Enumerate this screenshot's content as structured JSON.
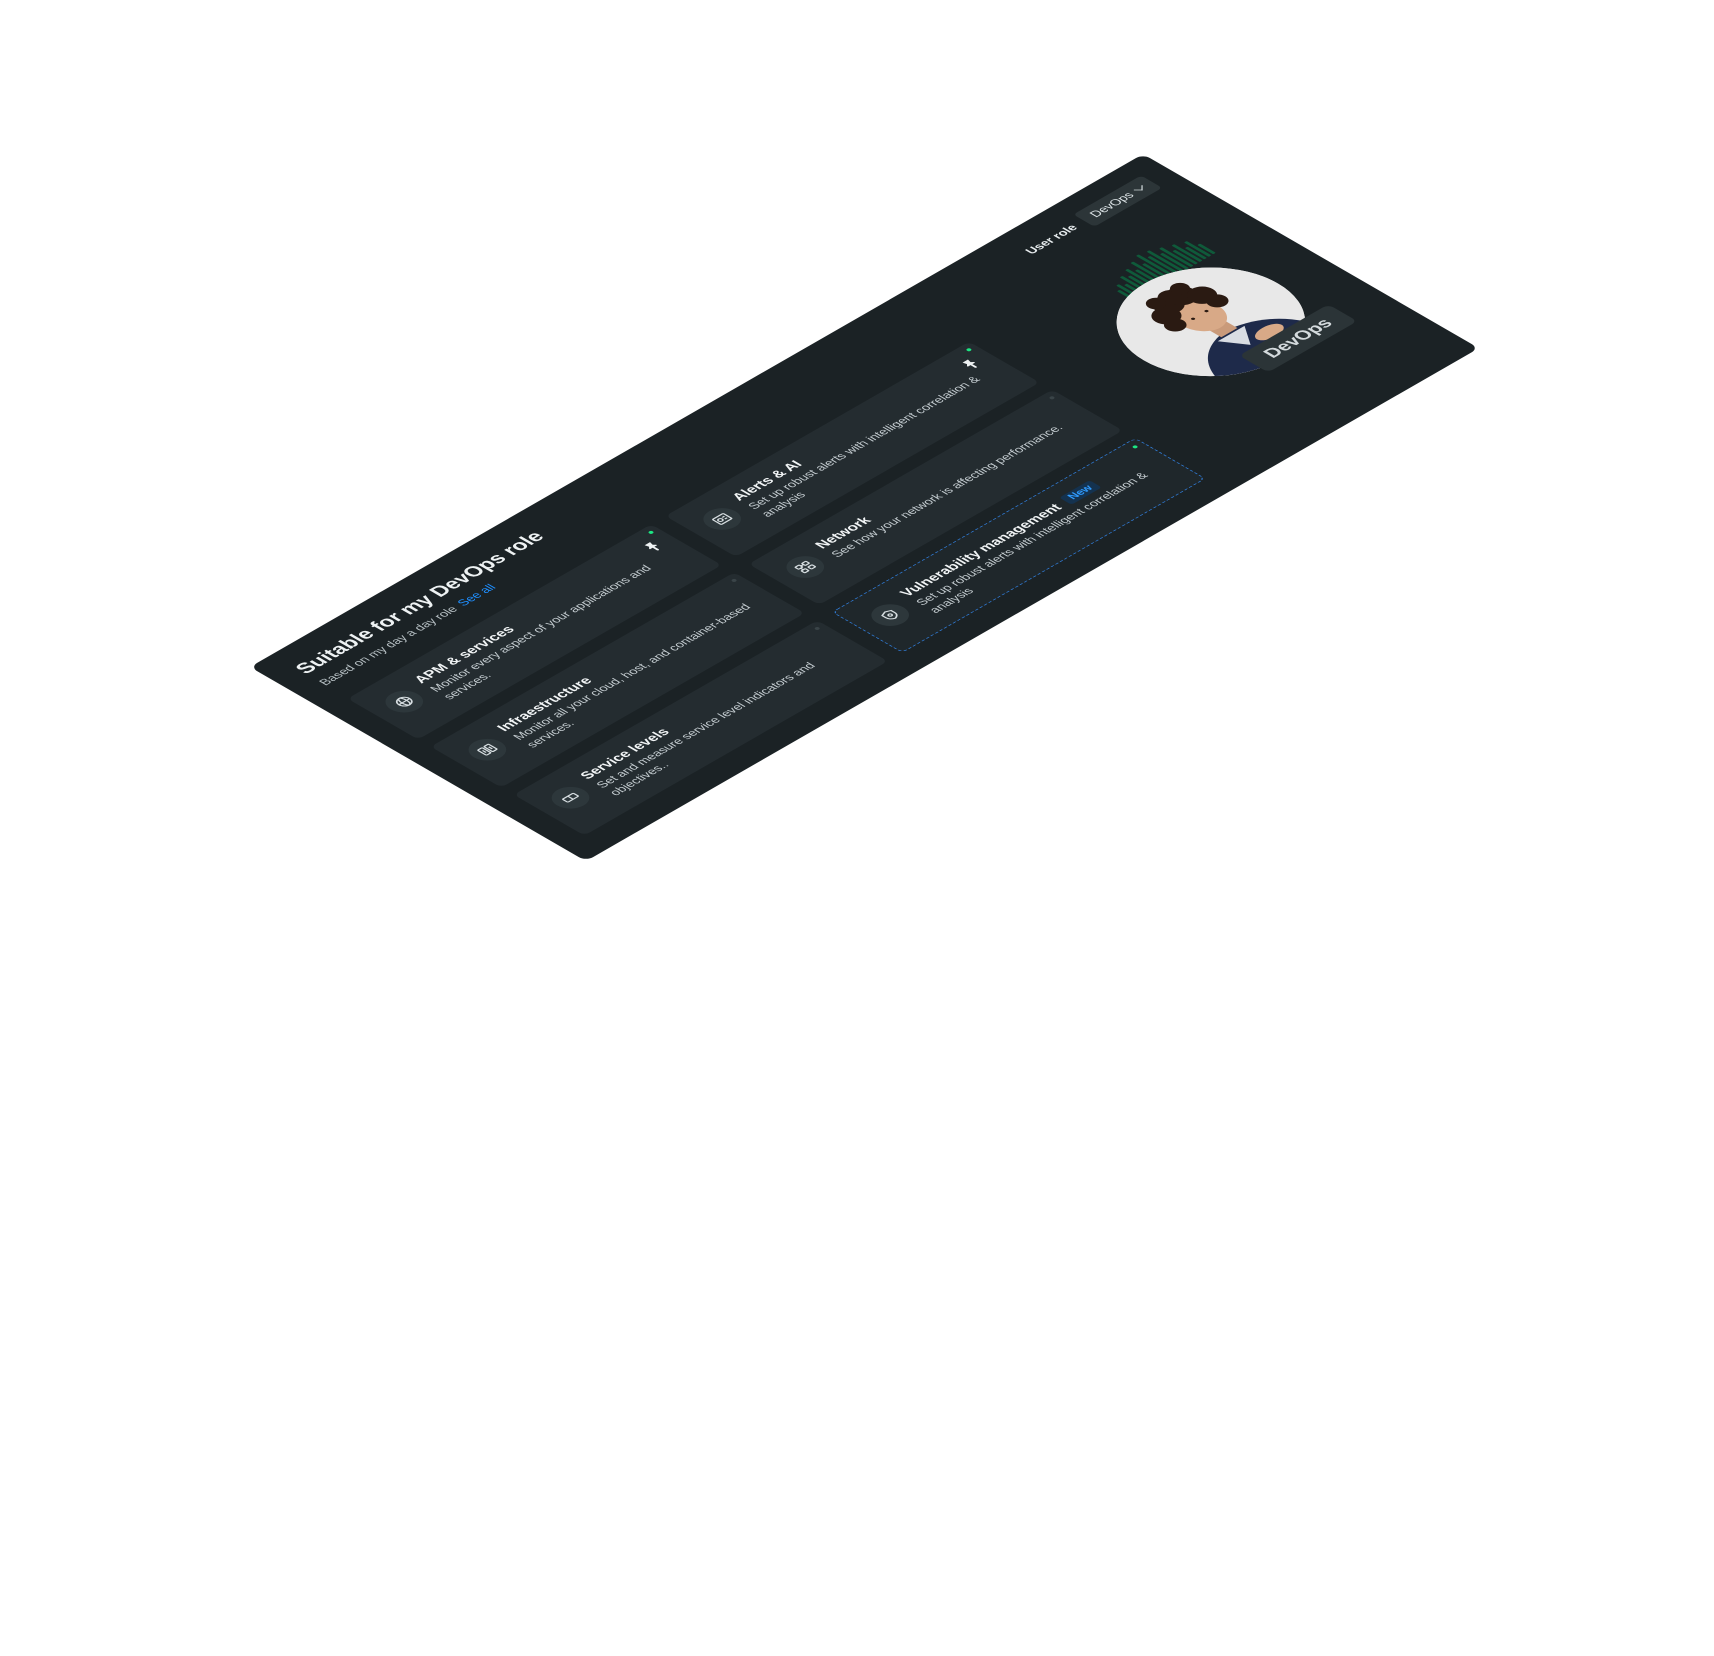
{
  "header": {
    "title": "Suitable for my DevOps role",
    "subtitle": "Based on my day a day role",
    "see_all": "See all"
  },
  "role": {
    "label": "User role",
    "selected": "DevOps"
  },
  "cards": [
    {
      "title": "APM & services",
      "desc": "Monitor every aspect of your applications and services.",
      "icon": "globe-icon",
      "pinned": true,
      "status": "green"
    },
    {
      "title": "Alerts & AI",
      "desc": "Set up robust alerts with intelligent correlation & analysis",
      "icon": "alert-panel-icon",
      "pinned": true,
      "status": "green"
    },
    {
      "title": "Infraestructure",
      "desc": "Monitor all your cloud, host, and container-based services.",
      "icon": "server-icon",
      "pinned": false,
      "status": "grey"
    },
    {
      "title": "Network",
      "desc": "See how your network is affecting performance.",
      "icon": "network-icon",
      "pinned": false,
      "status": "grey"
    },
    {
      "title": "Service levels",
      "desc": "Set and measure service level indicators and objectives..",
      "icon": "ticket-icon",
      "pinned": false,
      "status": "grey"
    },
    {
      "title": "Vulnerability management",
      "badge": "New",
      "desc": "Set up robust alerts with intelligent correlation & analysis",
      "icon": "shield-icon",
      "pinned": false,
      "status": "green"
    }
  ],
  "persona": {
    "label": "DevOps"
  },
  "colors": {
    "panel_bg": "#1b2225",
    "card_bg": "#242c30",
    "accent_blue": "#1f8fff",
    "status_green": "#1ce783",
    "bars_green": "#0f5a3a"
  }
}
